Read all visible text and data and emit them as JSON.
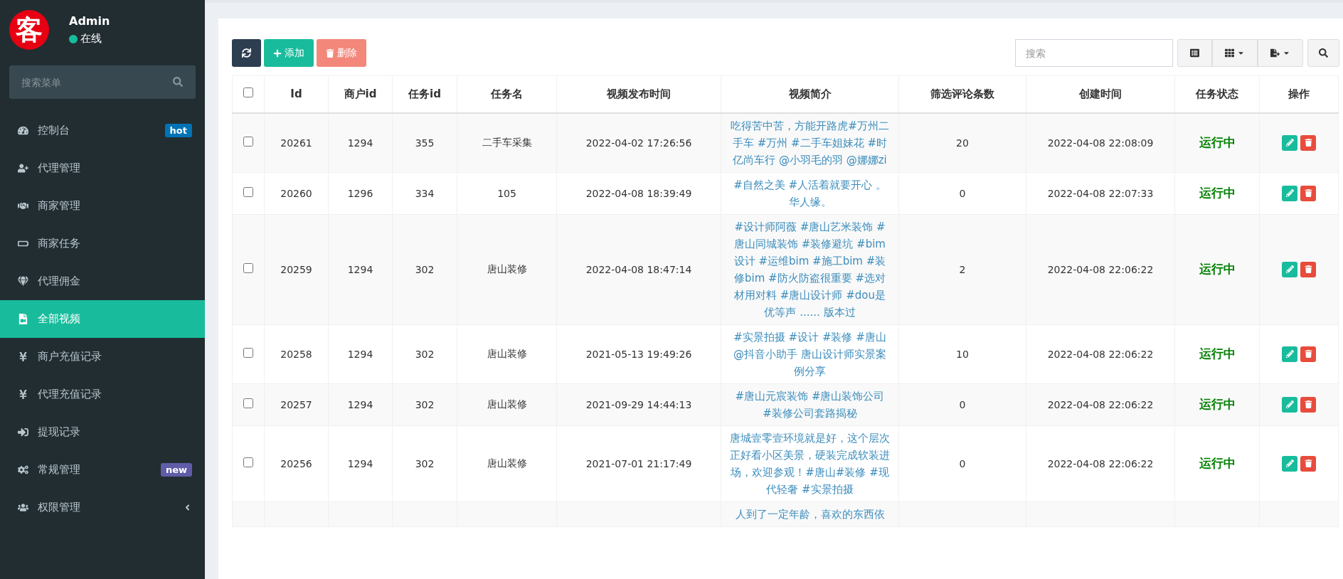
{
  "user": {
    "avatar_text": "客",
    "name": "Admin",
    "status": "在线"
  },
  "sidebar": {
    "search_placeholder": "搜索菜单",
    "items": [
      {
        "label": "控制台",
        "selected": false,
        "badge": {
          "label": "hot",
          "color": "#0073b7"
        }
      },
      {
        "label": "代理管理",
        "selected": false
      },
      {
        "label": "商家管理",
        "selected": false
      },
      {
        "label": "商家任务",
        "selected": false
      },
      {
        "label": "代理佣金",
        "selected": false
      },
      {
        "label": "全部视频",
        "selected": true
      },
      {
        "label": "商户充值记录",
        "selected": false
      },
      {
        "label": "代理充值记录",
        "selected": false
      },
      {
        "label": "提现记录",
        "selected": false
      },
      {
        "label": "常规管理",
        "selected": false,
        "badge": {
          "label": "new",
          "color": "#605ca8"
        }
      },
      {
        "label": "权限管理",
        "selected": false,
        "expanded": false
      }
    ]
  },
  "toolbar": {
    "add": "添加",
    "delete": "删除",
    "search_placeholder": "搜索"
  },
  "table": {
    "header_checked": false,
    "columns": [
      "Id",
      "商户id",
      "任务id",
      "任务名",
      "视频发布时间",
      "视频简介",
      "筛选评论条数",
      "创建时间",
      "任务状态",
      "操作"
    ],
    "rows": [
      {
        "checked": false,
        "id": "20261",
        "merchant_id": "1294",
        "task_id": "355",
        "task_name": "二手车采集",
        "published": "2022-04-02 17:26:56",
        "description": "吃得苦中苦，方能开路虎#万州二手车 #万州 #二手车姐妹花 #时亿尚车行 @小羽毛的羽 @娜娜zi",
        "comments": "20",
        "created": "2022-04-08 22:08:09",
        "status": "运行中",
        "running": true
      },
      {
        "checked": false,
        "id": "20260",
        "merchant_id": "1296",
        "task_id": "334",
        "task_name": "105",
        "published": "2022-04-08 18:39:49",
        "description": "#自然之美 #人活着就要开心 。华人缘。",
        "comments": "0",
        "created": "2022-04-08 22:07:33",
        "status": "运行中",
        "running": true
      },
      {
        "checked": false,
        "id": "20259",
        "merchant_id": "1294",
        "task_id": "302",
        "task_name": "唐山装修",
        "published": "2022-04-08 18:47:14",
        "description": "#设计师阿薇 #唐山艺米装饰 #唐山同城装饰 #装修避坑 #bim设计 #运维bim #施工bim #装修bim #防火防盗很重要 #选对材用对料 #唐山设计师 #dou是优等声 ...... 版本过",
        "comments": "2",
        "created": "2022-04-08 22:06:22",
        "status": "运行中",
        "running": true
      },
      {
        "checked": false,
        "id": "20258",
        "merchant_id": "1294",
        "task_id": "302",
        "task_name": "唐山装修",
        "published": "2021-05-13 19:49:26",
        "description": "#实景拍摄 #设计 #装修 #唐山 @抖音小助手 唐山设计师实景案例分享",
        "comments": "10",
        "created": "2022-04-08 22:06:22",
        "status": "运行中",
        "running": true
      },
      {
        "checked": false,
        "id": "20257",
        "merchant_id": "1294",
        "task_id": "302",
        "task_name": "唐山装修",
        "published": "2021-09-29 14:44:13",
        "description": "#唐山元宸装饰 #唐山装饰公司 #装修公司套路揭秘",
        "comments": "0",
        "created": "2022-04-08 22:06:22",
        "status": "运行中",
        "running": true
      },
      {
        "checked": false,
        "id": "20256",
        "merchant_id": "1294",
        "task_id": "302",
        "task_name": "唐山装修",
        "published": "2021-07-01 21:17:49",
        "description": "唐城壹零壹环境就是好，这个层次正好看小区美景，硬装完成软装进场，欢迎参观！#唐山#装修 #现代轻奢 #实景拍摄",
        "comments": "0",
        "created": "2022-04-08 22:06:22",
        "status": "运行中",
        "running": true
      },
      {
        "description": "人到了一定年龄，喜欢的东西依"
      }
    ]
  }
}
